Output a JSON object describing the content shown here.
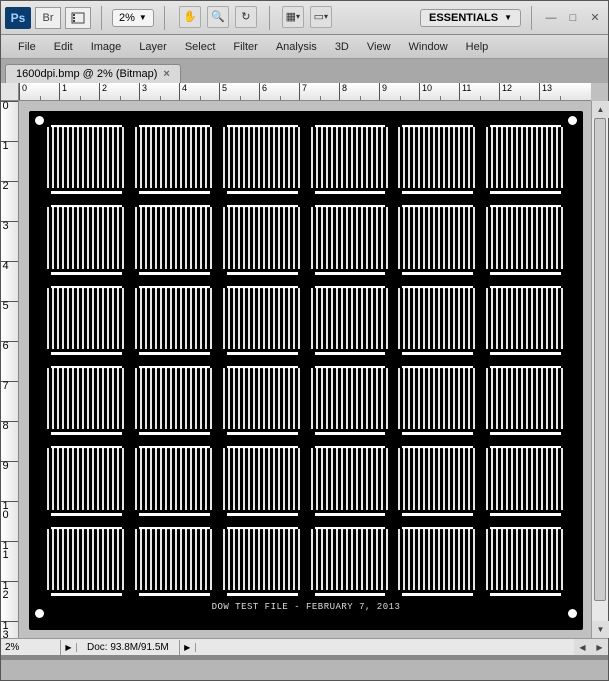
{
  "titlebar": {
    "app_abbr": "Ps",
    "bridge_abbr": "Br",
    "zoom_label": "2%",
    "workspace_label": "ESSENTIALS"
  },
  "menu": {
    "items": [
      "File",
      "Edit",
      "Image",
      "Layer",
      "Select",
      "Filter",
      "Analysis",
      "3D",
      "View",
      "Window",
      "Help"
    ]
  },
  "tab": {
    "label": "1600dpi.bmp @ 2% (Bitmap)"
  },
  "rulers": {
    "h": [
      "0",
      "1",
      "2",
      "3",
      "4",
      "5",
      "6",
      "7",
      "8",
      "9",
      "10",
      "11",
      "12",
      "13"
    ],
    "v": [
      "0",
      "1",
      "2",
      "3",
      "4",
      "5",
      "6",
      "7",
      "8",
      "9",
      "10",
      "11",
      "12",
      "13"
    ]
  },
  "canvas": {
    "footer_text": "DOW TEST FILE - FEBRUARY 7, 2013",
    "grid_rows": 6,
    "grid_cols": 6
  },
  "statusbar": {
    "zoom": "2%",
    "doc_info": "Doc: 93.8M/91.5M"
  }
}
